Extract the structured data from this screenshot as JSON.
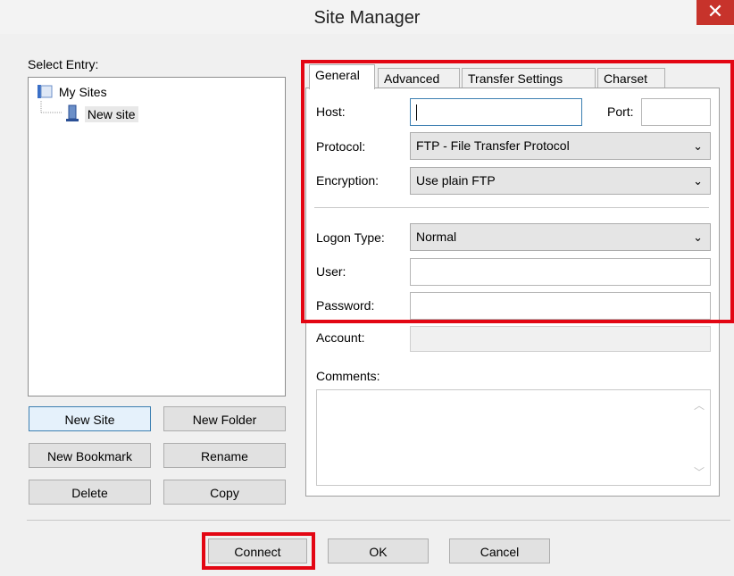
{
  "window": {
    "title": "Site Manager",
    "close_glyph": "✕"
  },
  "left": {
    "select_entry_label": "Select Entry:",
    "tree": {
      "root": "My Sites",
      "child": "New site"
    },
    "buttons": {
      "new_site": "New Site",
      "new_folder": "New Folder",
      "new_bookmark": "New Bookmark",
      "rename": "Rename",
      "delete": "Delete",
      "copy": "Copy"
    }
  },
  "tabs": [
    "General",
    "Advanced",
    "Transfer Settings",
    "Charset"
  ],
  "general": {
    "host_label": "Host:",
    "host_value": "",
    "port_label": "Port:",
    "port_value": "",
    "protocol_label": "Protocol:",
    "protocol_value": "FTP - File Transfer Protocol",
    "encryption_label": "Encryption:",
    "encryption_value": "Use plain FTP",
    "logon_type_label": "Logon Type:",
    "logon_type_value": "Normal",
    "user_label": "User:",
    "user_value": "",
    "password_label": "Password:",
    "password_value": "",
    "account_label": "Account:",
    "comments_label": "Comments:"
  },
  "footer": {
    "connect": "Connect",
    "ok": "OK",
    "cancel": "Cancel"
  },
  "icons": {
    "chevron": "⌄",
    "scroll_up": "︿",
    "scroll_down": "﹀"
  },
  "colors": {
    "highlight": "#e30613",
    "close": "#c7332b"
  }
}
